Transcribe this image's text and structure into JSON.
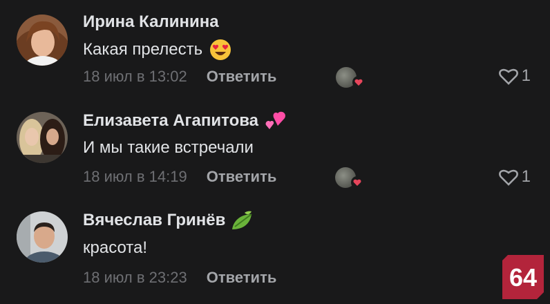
{
  "comments": [
    {
      "author": "Ирина Калинина",
      "text": "Какая прелесть",
      "text_emoji": "heart-eyes-emoji",
      "date": "18 июл в 13:02",
      "reply_label": "Ответить",
      "likes": "1"
    },
    {
      "author": "Елизавета Агапитова",
      "author_badge": "pink-heart-badge",
      "text": "И мы такие встречали",
      "date": "18 июл в 14:19",
      "reply_label": "Ответить",
      "likes": "1"
    },
    {
      "author": "Вячеслав Гринёв",
      "author_badge": "green-leaf-badge",
      "text": "красота!",
      "date": "18 июл в 23:23",
      "reply_label": "Ответить"
    }
  ],
  "logo": {
    "text": "64",
    "color": "#b3243b"
  },
  "colors": {
    "background": "#19191a",
    "like_heart_badge": "#e6455b"
  }
}
